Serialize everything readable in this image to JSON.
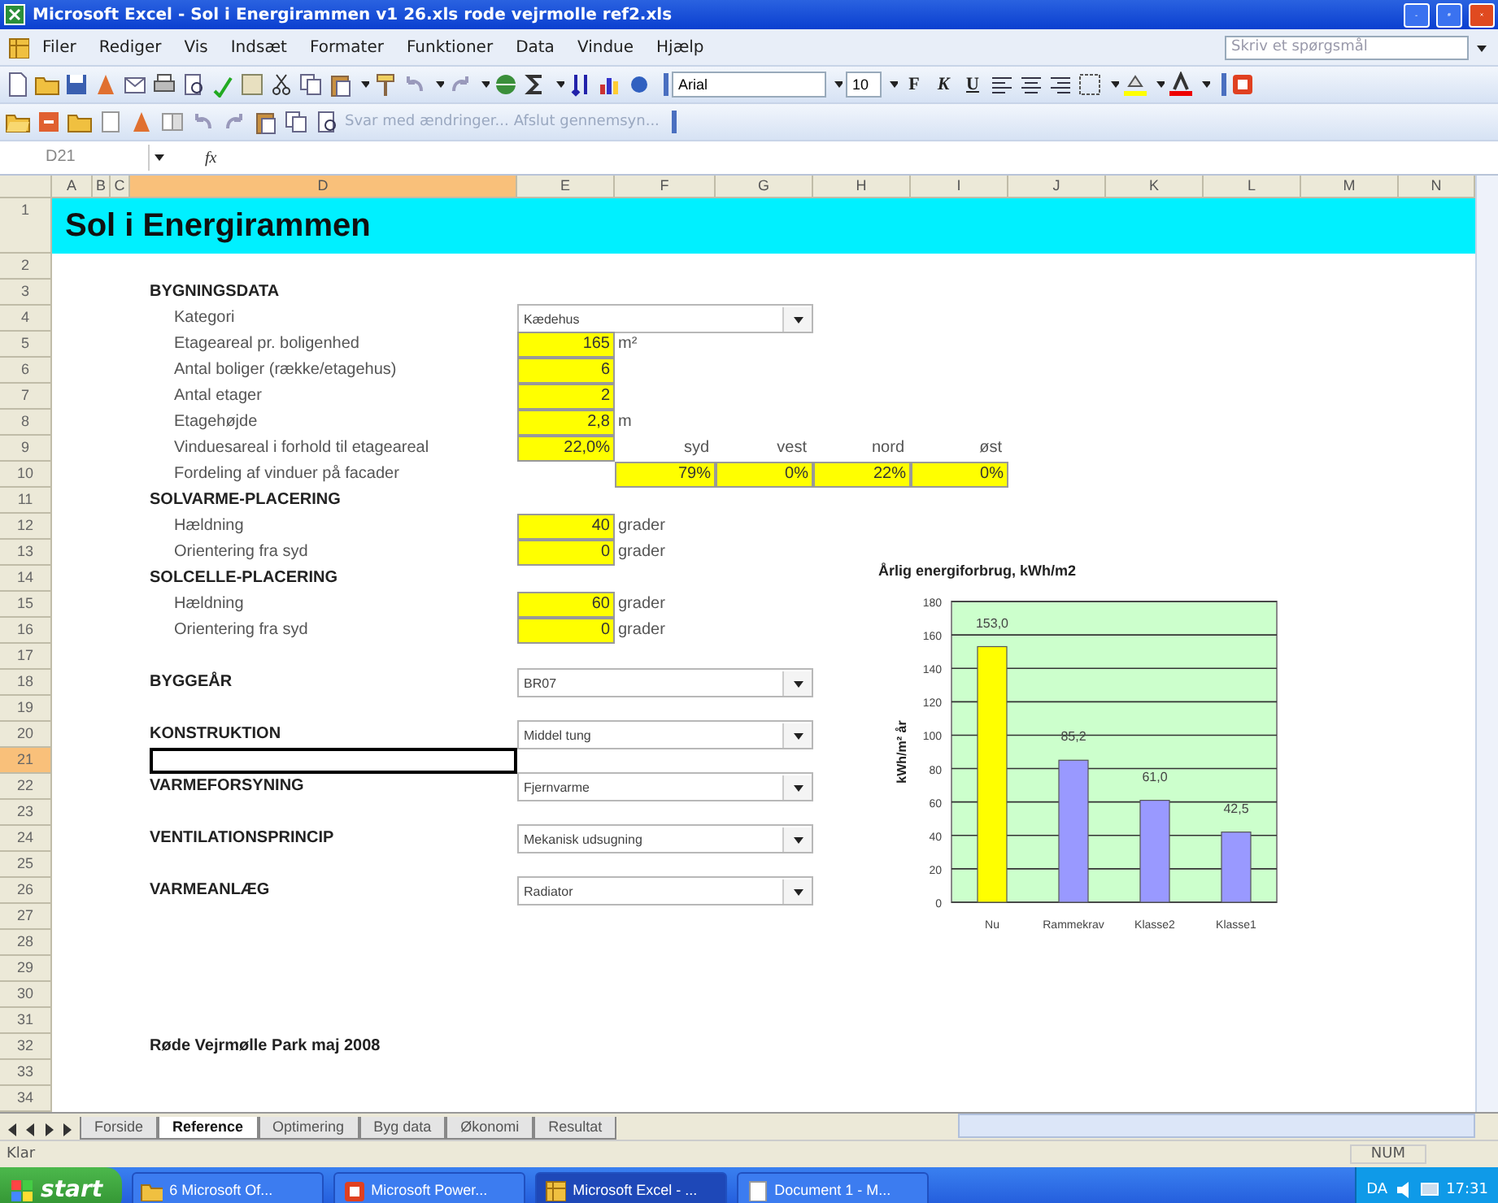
{
  "window": {
    "title": "Microsoft Excel - Sol i Energirammen v1 26.xls rode vejrmolle ref2.xls"
  },
  "menu": [
    "Filer",
    "Rediger",
    "Vis",
    "Indsæt",
    "Formater",
    "Funktioner",
    "Data",
    "Vindue",
    "Hjælp"
  ],
  "help_box": {
    "placeholder": "Skriv et spørgsmål"
  },
  "formatting": {
    "font": "Arial",
    "size": "10",
    "bold": "F",
    "italic": "K",
    "underline": "U"
  },
  "review_toolbar": {
    "reply": "Svar med ændringer...",
    "end": "Afslut gennemsyn...",
    "disabled": true
  },
  "formula_bar": {
    "name_box": "D21",
    "fx": "fx"
  },
  "columns": [
    {
      "label": "A",
      "selected": false
    },
    {
      "label": "B",
      "selected": false
    },
    {
      "label": "C",
      "selected": false
    },
    {
      "label": "D",
      "selected": true
    },
    {
      "label": "E",
      "selected": false
    },
    {
      "label": "F",
      "selected": false
    },
    {
      "label": "G",
      "selected": false
    },
    {
      "label": "H",
      "selected": false
    },
    {
      "label": "I",
      "selected": false
    },
    {
      "label": "J",
      "selected": false
    },
    {
      "label": "K",
      "selected": false
    },
    {
      "label": "L",
      "selected": false
    },
    {
      "label": "M",
      "selected": false
    },
    {
      "label": "N",
      "selected": false
    }
  ],
  "rows": [
    {
      "num": "1",
      "kind": "title",
      "text": "Sol i Energirammen",
      "selected": false
    },
    {
      "num": "2",
      "kind": "blank",
      "selected": false
    },
    {
      "num": "3",
      "kind": "heading",
      "text": "BYGNINGSDATA",
      "selected": false
    },
    {
      "num": "4",
      "kind": "dropdown",
      "label": "Kategori",
      "value": "Kædehus",
      "selected": false
    },
    {
      "num": "5",
      "kind": "input",
      "label": "Etageareal pr. boligenhed",
      "value": "165",
      "unit": "m²",
      "selected": false
    },
    {
      "num": "6",
      "kind": "input",
      "label": "Antal boliger (række/etagehus)",
      "value": "6",
      "selected": false
    },
    {
      "num": "7",
      "kind": "input",
      "label": "Antal etager",
      "value": "2",
      "selected": false
    },
    {
      "num": "8",
      "kind": "input",
      "label": "Etagehøjde",
      "value": "2,8",
      "unit": "m",
      "selected": false
    },
    {
      "num": "9",
      "kind": "input",
      "label": "Vinduesareal i forhold til etageareal",
      "value": "22,0%",
      "directions": [
        "syd",
        "vest",
        "nord",
        "øst"
      ],
      "selected": false
    },
    {
      "num": "10",
      "kind": "distribution",
      "label": "Fordeling af vinduer på facader",
      "values": [
        "79%",
        "0%",
        "22%",
        "0%"
      ],
      "selected": false
    },
    {
      "num": "11",
      "kind": "heading",
      "text": "SOLVARME-PLACERING",
      "selected": false
    },
    {
      "num": "12",
      "kind": "input",
      "label": "Hældning",
      "value": "40",
      "unit": "grader",
      "selected": false
    },
    {
      "num": "13",
      "kind": "input",
      "label": "Orientering fra syd",
      "value": "0",
      "unit": "grader",
      "selected": false
    },
    {
      "num": "14",
      "kind": "heading",
      "text": "SOLCELLE-PLACERING",
      "selected": false
    },
    {
      "num": "15",
      "kind": "input",
      "label": "Hældning",
      "value": "60",
      "unit": "grader",
      "selected": false
    },
    {
      "num": "16",
      "kind": "input",
      "label": "Orientering fra syd",
      "value": "0",
      "unit": "grader",
      "selected": false
    },
    {
      "num": "17",
      "kind": "blank",
      "selected": false
    },
    {
      "num": "18",
      "kind": "heading_dropdown",
      "text": "BYGGEÅR",
      "value": "BR07",
      "selected": false
    },
    {
      "num": "19",
      "kind": "blank",
      "selected": false
    },
    {
      "num": "20",
      "kind": "heading_dropdown",
      "text": "KONSTRUKTION",
      "value": "Middel tung",
      "selected": false
    },
    {
      "num": "21",
      "kind": "blank",
      "selected": true
    },
    {
      "num": "22",
      "kind": "heading_dropdown",
      "text": "VARMEFORSYNING",
      "value": "Fjernvarme",
      "selected": false
    },
    {
      "num": "23",
      "kind": "blank",
      "selected": false
    },
    {
      "num": "24",
      "kind": "heading_dropdown",
      "text": "VENTILATIONSPRINCIP",
      "value": "Mekanisk udsugning",
      "selected": false
    },
    {
      "num": "25",
      "kind": "blank",
      "selected": false
    },
    {
      "num": "26",
      "kind": "heading_dropdown",
      "text": "VARMEANLÆG",
      "value": "Radiator",
      "selected": false
    },
    {
      "num": "27",
      "kind": "blank",
      "selected": false
    },
    {
      "num": "28",
      "kind": "blank",
      "selected": false
    },
    {
      "num": "29",
      "kind": "blank",
      "selected": false
    },
    {
      "num": "30",
      "kind": "blank",
      "selected": false
    },
    {
      "num": "31",
      "kind": "blank",
      "selected": false
    },
    {
      "num": "32",
      "kind": "note",
      "text": "Røde Vejrmølle Park  maj 2008",
      "selected": false
    },
    {
      "num": "33",
      "kind": "blank",
      "selected": false
    },
    {
      "num": "34",
      "kind": "blank",
      "selected": false
    }
  ],
  "chart_data": {
    "type": "bar",
    "title": "Årlig energiforbrug, kWh/m2",
    "ylabel": "kWh/m² år",
    "categories": [
      "Nu",
      "Rammekrav",
      "Klasse2",
      "Klasse1"
    ],
    "series": [
      {
        "color": "#ffff00",
        "values": [
          153,
          null,
          null,
          null
        ]
      },
      {
        "color": "#9999ff",
        "values": [
          null,
          85,
          61,
          42
        ]
      }
    ],
    "stacked": true,
    "grid": true,
    "value_labels": [
      "153,0",
      "85,2",
      "61,0",
      "42,5"
    ],
    "ylim": [
      0,
      180
    ],
    "yticks": [
      0,
      20,
      40,
      60,
      80,
      100,
      120,
      140,
      160,
      180
    ]
  },
  "sheet_tabs": [
    {
      "label": "Forside",
      "selected": false
    },
    {
      "label": "Reference",
      "selected": true
    },
    {
      "label": "Optimering",
      "selected": false
    },
    {
      "label": "Byg data",
      "selected": false
    },
    {
      "label": "Økonomi",
      "selected": false
    },
    {
      "label": "Resultat",
      "selected": false
    }
  ],
  "status_bar": {
    "left": "Klar",
    "right": "NUM"
  },
  "taskbar": {
    "start": "start",
    "items": [
      {
        "label": "6 Microsoft Of...",
        "selected": false
      },
      {
        "label": "Microsoft Power...",
        "selected": false
      },
      {
        "label": "Microsoft Excel - ...",
        "selected": true
      },
      {
        "label": "Document 1 - M...",
        "selected": false
      }
    ],
    "tray": "DA",
    "clock": "17:31"
  }
}
